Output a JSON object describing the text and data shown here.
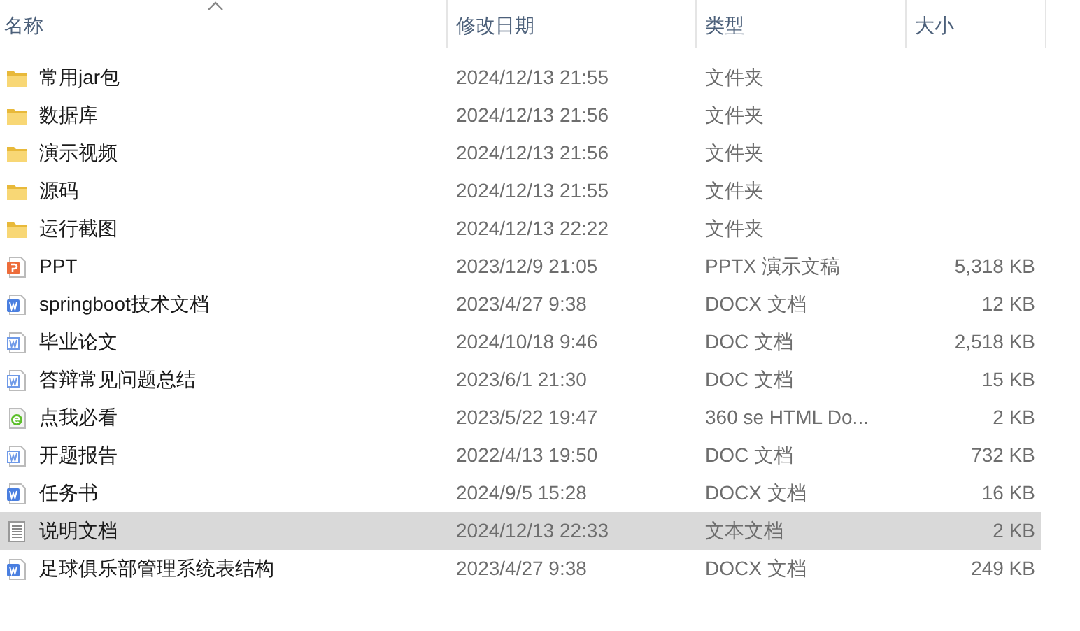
{
  "columns": [
    {
      "label": "名称",
      "sorted": true
    },
    {
      "label": "修改日期",
      "sorted": false
    },
    {
      "label": "类型",
      "sorted": false
    },
    {
      "label": "大小",
      "sorted": false
    }
  ],
  "files": [
    {
      "name": "常用jar包",
      "kind": "folder",
      "modified": "2024/12/13 21:55",
      "type": "文件夹",
      "selected": false
    },
    {
      "name": "数据库",
      "kind": "folder",
      "modified": "2024/12/13 21:56",
      "type": "文件夹",
      "selected": false
    },
    {
      "name": "演示视频",
      "kind": "folder",
      "modified": "2024/12/13 21:56",
      "type": "文件夹",
      "selected": false
    },
    {
      "name": "源码",
      "kind": "folder",
      "modified": "2024/12/13 21:55",
      "type": "文件夹",
      "selected": false
    },
    {
      "name": "运行截图",
      "kind": "folder",
      "modified": "2024/12/13 22:22",
      "type": "文件夹",
      "selected": false
    },
    {
      "name": "PPT",
      "kind": "pptx",
      "modified": "2023/12/9 21:05",
      "type": "PPTX 演示文稿",
      "size": "5,318 KB",
      "selected": false
    },
    {
      "name": "springboot技术文档",
      "kind": "docx",
      "modified": "2023/4/27 9:38",
      "type": "DOCX 文档",
      "size": "12 KB",
      "selected": false
    },
    {
      "name": "毕业论文",
      "kind": "doc",
      "modified": "2024/10/18 9:46",
      "type": "DOC 文档",
      "size": "2,518 KB",
      "selected": false
    },
    {
      "name": "答辩常见问题总结",
      "kind": "doc",
      "modified": "2023/6/1 21:30",
      "type": "DOC 文档",
      "size": "15 KB",
      "selected": false
    },
    {
      "name": "点我必看",
      "kind": "html",
      "modified": "2023/5/22 19:47",
      "type": "360 se HTML Do...",
      "size": "2 KB",
      "selected": false
    },
    {
      "name": "开题报告",
      "kind": "doc",
      "modified": "2022/4/13 19:50",
      "type": "DOC 文档",
      "size": "732 KB",
      "selected": false
    },
    {
      "name": "任务书",
      "kind": "docx",
      "modified": "2024/9/5 15:28",
      "type": "DOCX 文档",
      "size": "16 KB",
      "selected": false
    },
    {
      "name": "说明文档",
      "kind": "txt",
      "modified": "2024/12/13 22:33",
      "type": "文本文档",
      "size": "2 KB",
      "selected": true
    },
    {
      "name": "足球俱乐部管理系统表结构",
      "kind": "docx",
      "modified": "2023/4/27 9:38",
      "type": "DOCX 文档",
      "size": "249 KB",
      "selected": false
    }
  ]
}
